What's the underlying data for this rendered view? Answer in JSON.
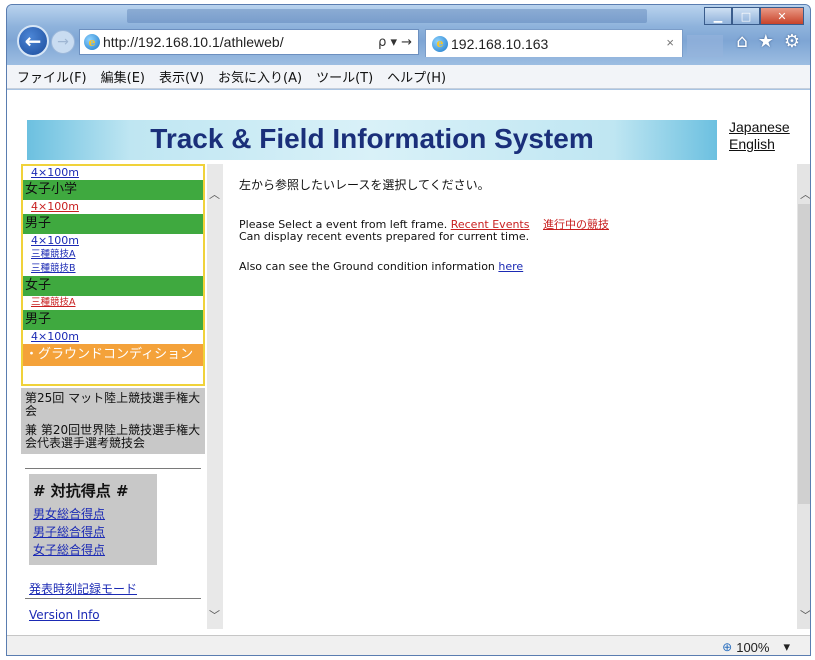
{
  "browser": {
    "address": "http://192.168.10.1/athleweb/",
    "address_tools": "ρ ▾ →",
    "tab_title": "192.168.10.163",
    "tab_close": "×",
    "zoom": "100%",
    "zoom_dropdown": "▾"
  },
  "window_controls": {
    "minimize": "▁",
    "maximize": "□",
    "close": "✕"
  },
  "menu": [
    "ファイル(F)",
    "編集(E)",
    "表示(V)",
    "お気に入り(A)",
    "ツール(T)",
    "ヘルプ(H)"
  ],
  "page": {
    "title": "Track & Field Information System",
    "lang_ja": "Japanese",
    "lang_en": "English"
  },
  "left_nav": {
    "top_link": "4×100m",
    "group1": "女子小学",
    "g1_link": "4×100m",
    "group2": "男子",
    "g2_link1": "4×100m",
    "g2_link2": "三種競技A",
    "g2_link3": "三種競技B",
    "group3": "女子",
    "g3_link": "三種競技A",
    "group4": "男子",
    "g4_link": "4×100m",
    "ground": "・グラウンドコンディション",
    "meet_name": "第25回 マット陸上競技選手権大会",
    "meet_sub": "兼 第20回世界陸上競技選手権大会代表選手選考競技会",
    "score_title": "# 対抗得点 #",
    "score_links": [
      "男女総合得点",
      "男子総合得点",
      "女子総合得点"
    ],
    "time_mode": "発表時刻記録モード",
    "version": "Version Info"
  },
  "main": {
    "instruction_jp": "左から参照したいレースを選択してください。",
    "line1_text": "Please Select a event from left frame.",
    "recent_events": "Recent Events",
    "in_progress": "進行中の競技",
    "line2_text": "Can display recent events prepared for current time.",
    "line3_text": "Also can see the Ground condition information",
    "here": "here"
  },
  "colors": {
    "nav_green": "#3fa93f",
    "nav_orange": "#f4a23a",
    "nav_border_yellow": "#f0d23a",
    "link_blue": "#1b2ab4",
    "link_red": "#c82020",
    "title_navy": "#1a2f7a"
  }
}
